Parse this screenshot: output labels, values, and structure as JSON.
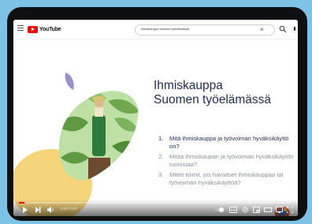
{
  "header": {
    "logo_text": "YouTube",
    "search_query": "ihmiskauppa suomen työelämässä"
  },
  "slide": {
    "title_line1": "Ihmiskauppa",
    "title_line2": "Suomen työelämässä",
    "questions": [
      {
        "num": "1.",
        "text": "Mitä ihmiskauppa ja työvoiman hyväksikäyttö on?"
      },
      {
        "num": "2.",
        "text": "Mistä ihmiskaupan ja työvoiman hyväksikäytön tunnistaa?"
      },
      {
        "num": "3.",
        "text": "Miten toimit, jos havaitset ihmiskauppaa tai työvoiman hyväksikäyttöä?"
      }
    ]
  },
  "player": {
    "time": "0:00 / 3:07",
    "progress": 0.02
  },
  "colors": {
    "accent": "#ff0000",
    "title": "#1e2d5a",
    "leaf_purple": "#9b90cf",
    "blob_yellow": "#f5d47a"
  },
  "icons": [
    "menu-icon",
    "youtube-logo-icon",
    "clear-icon",
    "search-icon",
    "mic-icon",
    "play-icon",
    "next-icon",
    "volume-icon",
    "autoplay-toggle-icon",
    "subtitles-icon",
    "settings-icon",
    "miniplayer-icon",
    "theater-icon",
    "cast-icon",
    "fullscreen-icon"
  ]
}
